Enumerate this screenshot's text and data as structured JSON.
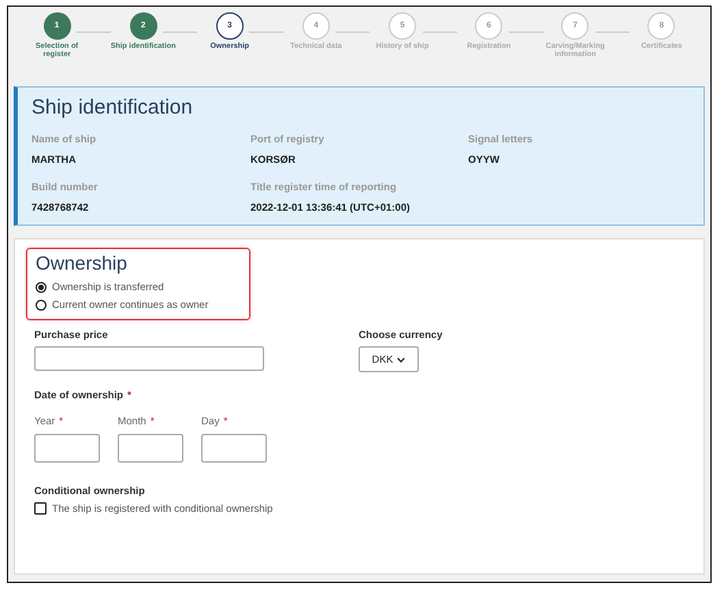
{
  "steps": [
    {
      "number": "1",
      "label": "Selection of register",
      "completed": true,
      "selected": false
    },
    {
      "number": "2",
      "label": "Ship identification",
      "completed": true,
      "selected": false
    },
    {
      "number": "3",
      "label": "Ownership",
      "completed": false,
      "selected": true
    },
    {
      "number": "4",
      "label": "Technical data",
      "completed": false,
      "selected": false
    },
    {
      "number": "5",
      "label": "History of ship",
      "completed": false,
      "selected": false
    },
    {
      "number": "6",
      "label": "Registration",
      "completed": false,
      "selected": false
    },
    {
      "number": "7",
      "label": "Carving/Marking information",
      "completed": false,
      "selected": false
    },
    {
      "number": "8",
      "label": "Certificates",
      "completed": false,
      "selected": false
    }
  ],
  "ship_identification": {
    "title": "Ship identification",
    "fields": [
      {
        "label": "Name of ship",
        "value": "MARTHA"
      },
      {
        "label": "Port of registry",
        "value": "KORSØR"
      },
      {
        "label": "Signal letters",
        "value": "OYYW"
      },
      {
        "label": "Build number",
        "value": "7428768742"
      },
      {
        "label": "Title register time of reporting",
        "value": "2022-12-01 13:36:41 (UTC+01:00)"
      }
    ]
  },
  "ownership": {
    "title": "Ownership",
    "options": [
      {
        "label": "Ownership is transferred",
        "selected": true
      },
      {
        "label": "Current owner continues as owner",
        "selected": false
      }
    ],
    "purchase_price": {
      "label": "Purchase price"
    },
    "currency": {
      "label": "Choose currency",
      "value": "DKK"
    },
    "date": {
      "label": "Date of ownership",
      "required_mark": "*",
      "parts": [
        {
          "label": "Year",
          "required_mark": "*"
        },
        {
          "label": "Month",
          "required_mark": "*"
        },
        {
          "label": "Day",
          "required_mark": "*"
        }
      ]
    },
    "conditional": {
      "label": "Conditional ownership",
      "checkbox_label": "The ship is registered with conditional ownership",
      "checked": false
    }
  }
}
